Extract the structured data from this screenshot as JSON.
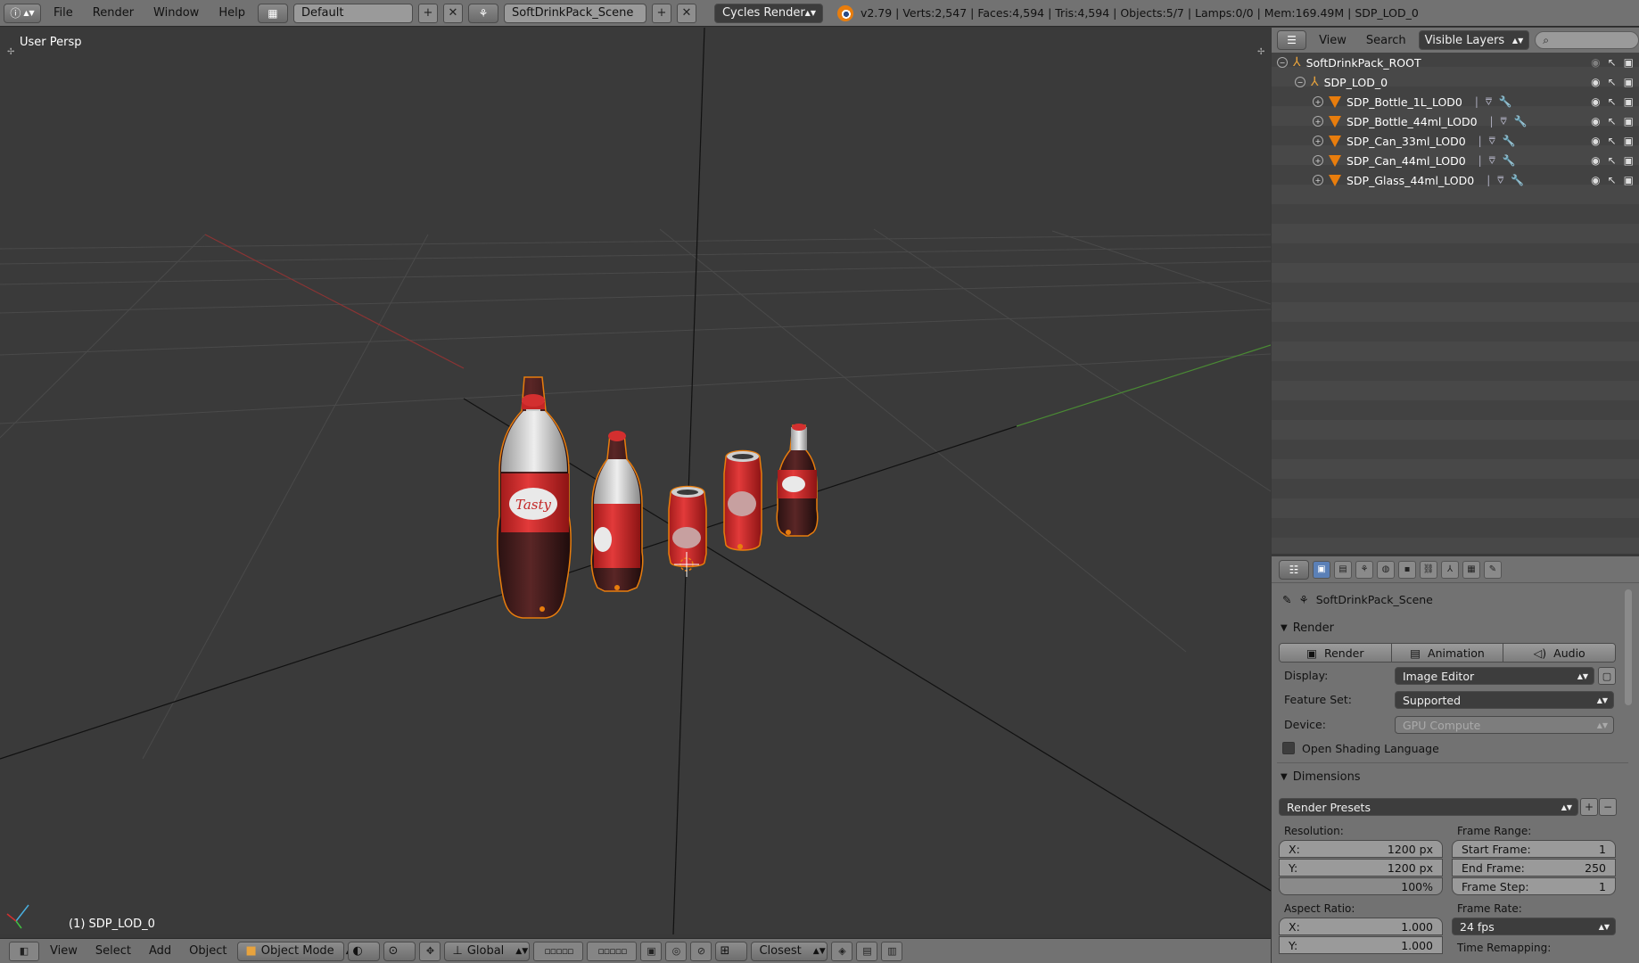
{
  "topbar": {
    "menus": [
      "File",
      "Render",
      "Window",
      "Help"
    ],
    "layout_name": "Default",
    "scene_name": "SoftDrinkPack_Scene",
    "engine": "Cycles Render",
    "stats": "v2.79 | Verts:2,547 | Faces:4,594 | Tris:4,594 | Objects:5/7 | Lamps:0/0 | Mem:169.49M | SDP_LOD_0"
  },
  "viewport": {
    "view_label": "User Persp",
    "object_label": "(1) SDP_LOD_0",
    "bottle_label_text": "Tasty",
    "colors": {
      "grid": "#4a4a4a",
      "x_axis": "#8a3434",
      "y_axis": "#4a8a34",
      "selection": "#e87d0d",
      "liquid": "#3a1a1a",
      "label_red": "#d32f2f"
    }
  },
  "footer": {
    "menus": [
      "View",
      "Select",
      "Add",
      "Object"
    ],
    "mode": "Object Mode",
    "orientation": "Global",
    "snap": "Closest"
  },
  "outliner": {
    "menus": [
      "View",
      "Search"
    ],
    "filter": "Visible Layers",
    "items": [
      {
        "name": "SoftDrinkPack_ROOT"
      },
      {
        "name": "SDP_LOD_0"
      },
      {
        "name": "SDP_Bottle_1L_LOD0"
      },
      {
        "name": "SDP_Bottle_44ml_LOD0"
      },
      {
        "name": "SDP_Can_33ml_LOD0"
      },
      {
        "name": "SDP_Can_44ml_LOD0"
      },
      {
        "name": "SDP_Glass_44ml_LOD0"
      }
    ]
  },
  "properties": {
    "scene": "SoftDrinkPack_Scene",
    "render_panel": "Render",
    "render_buttons": [
      "Render",
      "Animation",
      "Audio"
    ],
    "display_label": "Display:",
    "display_value": "Image Editor",
    "feature_label": "Feature Set:",
    "feature_value": "Supported",
    "device_label": "Device:",
    "device_value": "GPU Compute",
    "osl_label": "Open Shading Language",
    "dimensions_panel": "Dimensions",
    "presets": "Render Presets",
    "resolution_label": "Resolution:",
    "res_x_label": "X:",
    "res_x": "1200 px",
    "res_y_label": "Y:",
    "res_y": "1200 px",
    "res_pct": "100%",
    "frame_range_label": "Frame Range:",
    "start_label": "Start Frame:",
    "start": "1",
    "end_label": "End Frame:",
    "end": "250",
    "step_label": "Frame Step:",
    "step": "1",
    "aspect_label": "Aspect Ratio:",
    "asp_x_label": "X:",
    "asp_x": "1.000",
    "asp_y_label": "Y:",
    "asp_y": "1.000",
    "frame_rate_label": "Frame Rate:",
    "fps": "24 fps",
    "remap_label": "Time Remapping:"
  }
}
